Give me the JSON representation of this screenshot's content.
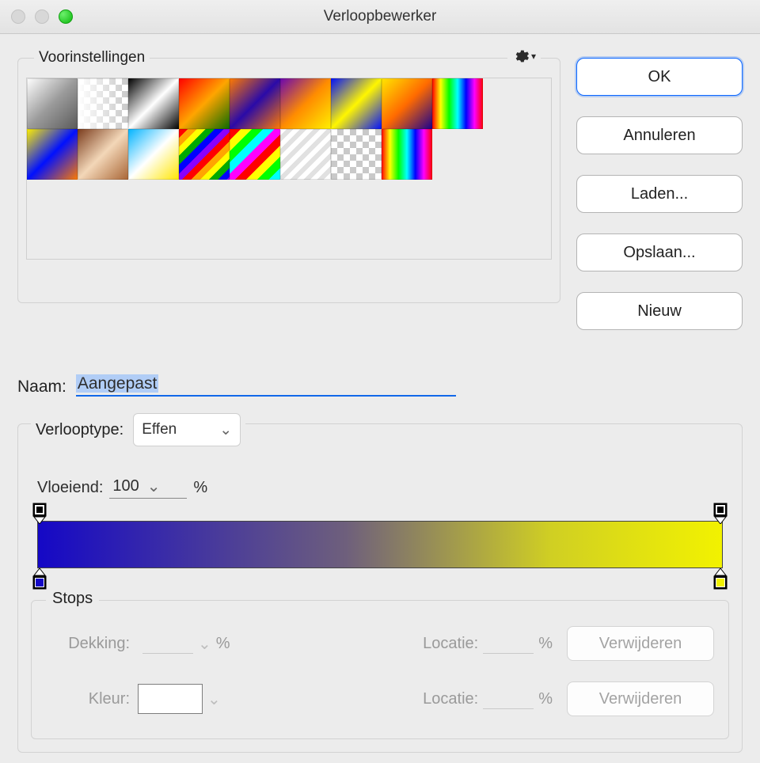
{
  "window": {
    "title": "Verloopbewerker"
  },
  "presets": {
    "legend": "Voorinstellingen",
    "icons": {
      "gear": "gear-icon"
    }
  },
  "buttons": {
    "ok": "OK",
    "cancel": "Annuleren",
    "load": "Laden...",
    "save": "Opslaan...",
    "new": "Nieuw"
  },
  "name": {
    "label": "Naam:",
    "value": "Aangepast"
  },
  "gradient": {
    "type_label": "Verlooptype:",
    "type_value": "Effen",
    "smooth_label": "Vloeiend:",
    "smooth_value": "100",
    "percent": "%",
    "stops": {
      "legend": "Stops",
      "opacity_label": "Dekking:",
      "color_label": "Kleur:",
      "location_label": "Locatie:",
      "remove": "Verwijderen"
    },
    "color_start": "#1508c6",
    "color_end": "#f2f200"
  }
}
